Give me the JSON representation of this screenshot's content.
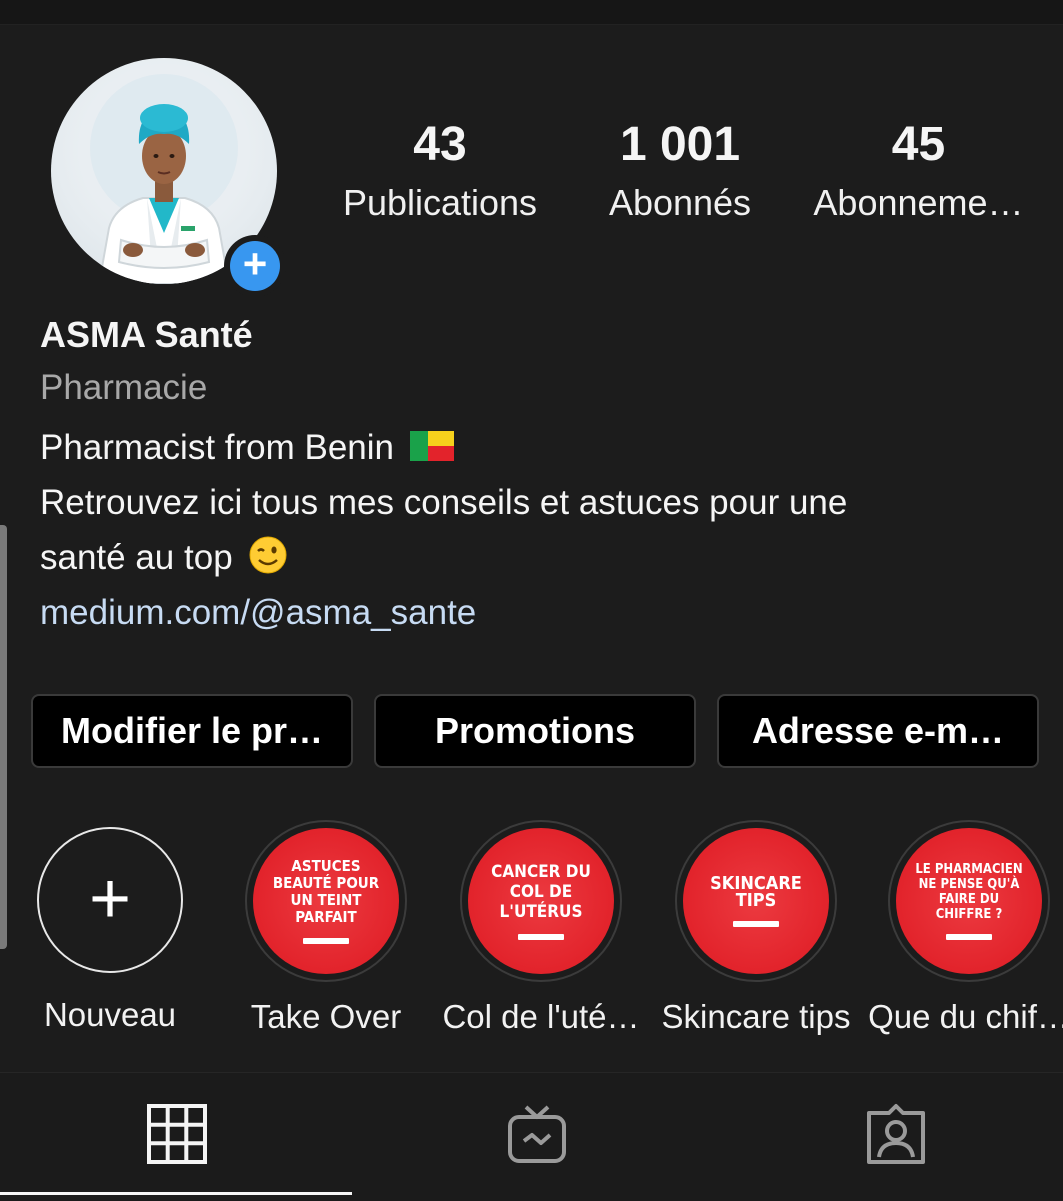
{
  "profile": {
    "name": "ASMA Santé",
    "category": "Pharmacie",
    "bio_line1": "Pharmacist from Benin",
    "bio_line2": "Retrouvez ici tous mes conseils et astuces pour une",
    "bio_line3": "santé au top",
    "link": "medium.com/@asma_sante",
    "flag_icon": "benin-flag-icon",
    "emoji_icon": "winking-face-icon"
  },
  "stats": [
    {
      "value": "43",
      "label": "Publications"
    },
    {
      "value": "1 001",
      "label": "Abonnés"
    },
    {
      "value": "45",
      "label": "Abonneme…"
    }
  ],
  "buttons": {
    "edit": "Modifier le pr…",
    "promotions": "Promotions",
    "email": "Adresse e-m…"
  },
  "highlights": [
    {
      "label": "Nouveau",
      "cover_text": ""
    },
    {
      "label": "Take Over",
      "cover_text": "ASTUCES BEAUTÉ POUR UN TEINT PARFAIT"
    },
    {
      "label": "Col de l'uté…",
      "cover_text": "CANCER DU COL DE L'UTÉRUS"
    },
    {
      "label": "Skincare tips",
      "cover_text": "SKINCARE TIPS"
    },
    {
      "label": "Que du chif…",
      "cover_text": "LE PHARMACIEN NE PENSE QU'À FAIRE DU CHIFFRE ?"
    }
  ],
  "tabs": [
    {
      "icon": "grid-icon",
      "active": true
    },
    {
      "icon": "igtv-icon",
      "active": false
    },
    {
      "icon": "tagged-icon",
      "active": false
    }
  ],
  "colors": {
    "background": "#1c1c1c",
    "accent_blue": "#3897f0",
    "highlight_red": "#e2232b",
    "link": "#c7dbf3",
    "secondary_text": "#a8a8a8"
  }
}
